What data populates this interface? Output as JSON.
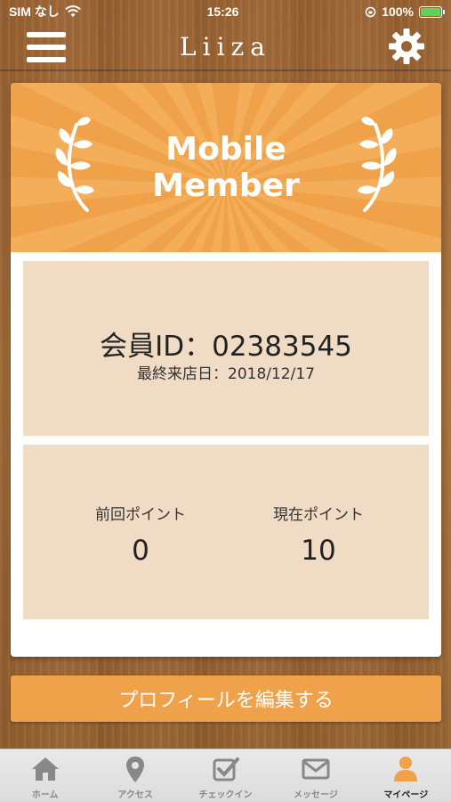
{
  "status_bar": {
    "carrier": "SIM なし",
    "time": "15:26",
    "battery": "100%"
  },
  "nav": {
    "title": "Liiza",
    "menu_icon": "hamburger-menu-icon",
    "settings_icon": "gear-icon"
  },
  "banner": {
    "line1": "Mobile",
    "line2": "Member"
  },
  "member": {
    "id_text": "会員ID：02383545",
    "last_visit": "最終来店日：2018/12/17"
  },
  "points": {
    "previous_label": "前回ポイント",
    "previous_value": "0",
    "current_label": "現在ポイント",
    "current_value": "10"
  },
  "edit_profile_label": "プロフィールを編集する",
  "tabs": [
    {
      "label": "ホーム",
      "icon": "home-icon",
      "active": false
    },
    {
      "label": "アクセス",
      "icon": "location-pin-icon",
      "active": false
    },
    {
      "label": "チェックイン",
      "icon": "checkin-icon",
      "active": false
    },
    {
      "label": "メッセージ",
      "icon": "mail-icon",
      "active": false
    },
    {
      "label": "マイページ",
      "icon": "user-icon",
      "active": true
    }
  ],
  "colors": {
    "accent": "#f0a24a",
    "panel": "#f0dcc5",
    "tab_inactive": "#888888",
    "tab_active": "#f0a24a"
  }
}
